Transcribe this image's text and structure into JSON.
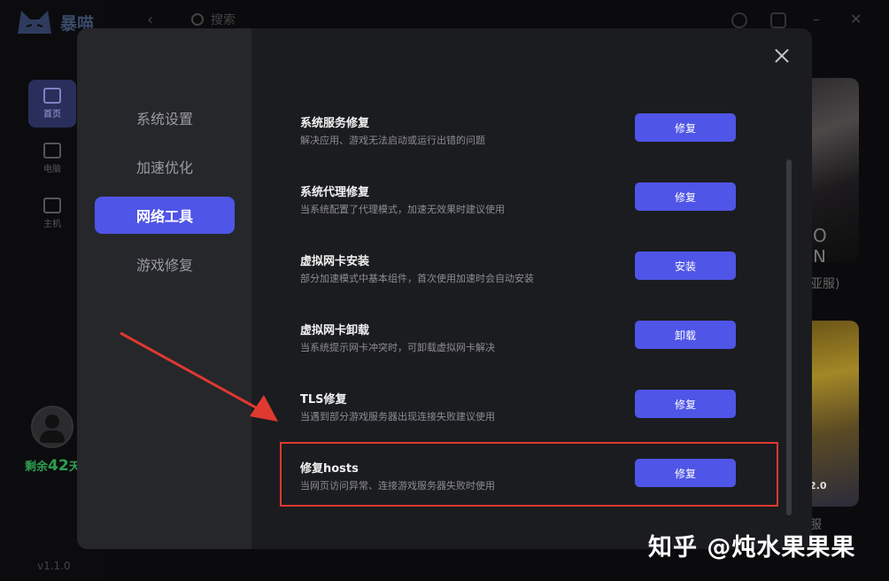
{
  "app": {
    "logo_text": "暴喵",
    "nav": [
      {
        "label": "首页",
        "icon": "home-icon"
      },
      {
        "label": "电脑",
        "icon": "monitor-icon"
      },
      {
        "label": "主机",
        "icon": "gamepad-icon"
      }
    ],
    "days_prefix": "剩余",
    "days_num": "42",
    "days_suffix": "天",
    "version": "v1.1.0"
  },
  "topbar": {
    "search_placeholder": "搜索"
  },
  "games": [
    {
      "label": "亚服)",
      "card_text": "O N"
    },
    {
      "label": "服",
      "card_text": "2.0"
    }
  ],
  "modal": {
    "nav_items": [
      {
        "label": "系统设置",
        "active": false
      },
      {
        "label": "加速优化",
        "active": false
      },
      {
        "label": "网络工具",
        "active": true
      },
      {
        "label": "游戏修复",
        "active": false
      }
    ],
    "tools": [
      {
        "title": "系统服务修复",
        "desc": "解决应用、游戏无法启动或运行出错的问题",
        "button": "修复"
      },
      {
        "title": "系统代理修复",
        "desc": "当系统配置了代理模式，加速无效果时建议使用",
        "button": "修复"
      },
      {
        "title": "虚拟网卡安装",
        "desc": "部分加速模式中基本组件，首次使用加速时会自动安装",
        "button": "安装"
      },
      {
        "title": "虚拟网卡卸载",
        "desc": "当系统提示网卡冲突时，可卸载虚拟网卡解决",
        "button": "卸载"
      },
      {
        "title": "TLS修复",
        "desc": "当遇到部分游戏服务器出现连接失败建议使用",
        "button": "修复"
      },
      {
        "title": "修复hosts",
        "desc": "当网页访问异常、连接游戏服务器失败时使用",
        "button": "修复"
      }
    ]
  },
  "annotations": {
    "watermark": "知乎 @炖水果果果",
    "highlight_color": "#e0392f",
    "accent_color": "#4f55e6"
  }
}
